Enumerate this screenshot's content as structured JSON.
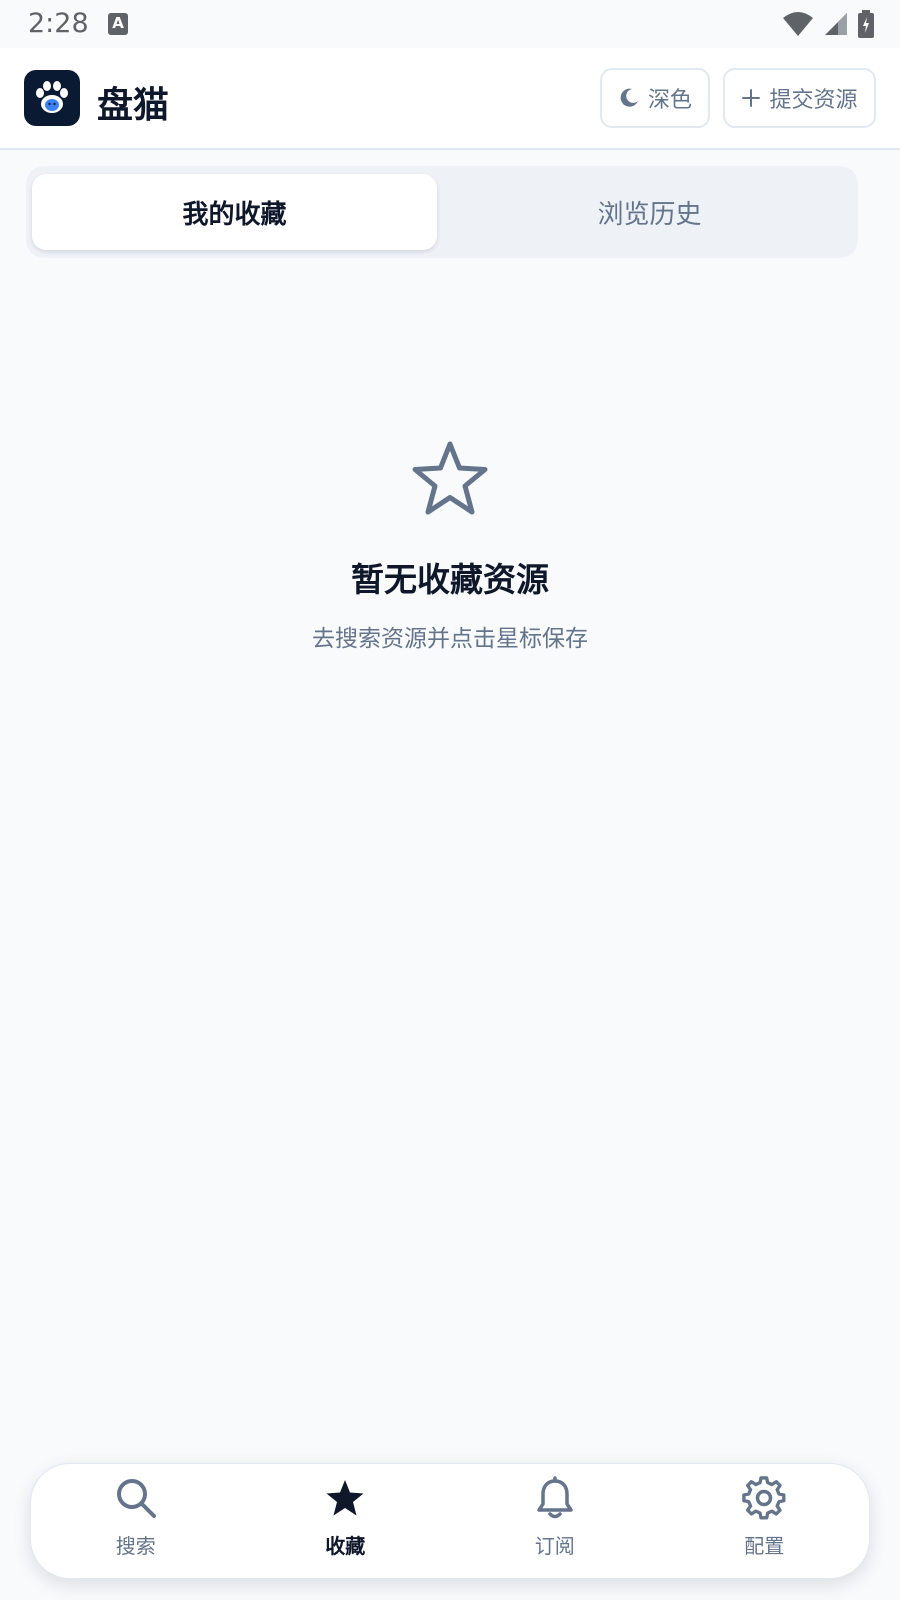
{
  "status_bar": {
    "time": "2:28",
    "input_indicator": "A"
  },
  "header": {
    "app_title": "盘猫",
    "dark_mode_label": "深色",
    "submit_label": "提交资源"
  },
  "tabs": [
    {
      "label": "我的收藏",
      "active": true
    },
    {
      "label": "浏览历史",
      "active": false
    }
  ],
  "empty_state": {
    "icon": "star-outline-icon",
    "title": "暂无收藏资源",
    "subtitle": "去搜索资源并点击星标保存"
  },
  "bottom_nav": {
    "items": [
      {
        "label": "搜索",
        "icon": "search-icon",
        "active": false
      },
      {
        "label": "收藏",
        "icon": "star-icon",
        "active": true
      },
      {
        "label": "订阅",
        "icon": "bell-icon",
        "active": false
      },
      {
        "label": "配置",
        "icon": "gear-icon",
        "active": false
      }
    ]
  },
  "colors": {
    "background": "#f8fafc",
    "primary_text": "#0f172a",
    "muted_text": "#64748b",
    "logo_bg": "#0b1a33"
  }
}
